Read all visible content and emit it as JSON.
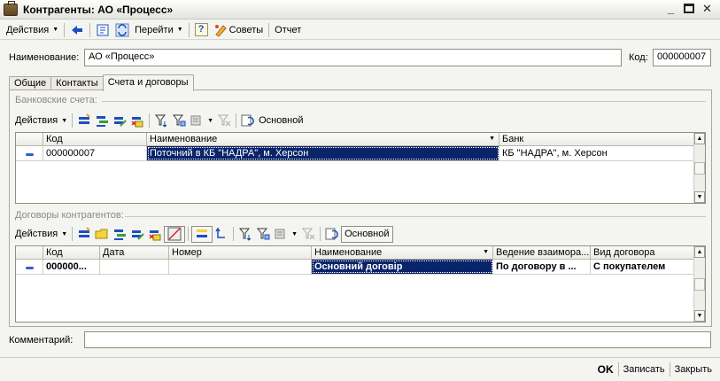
{
  "window": {
    "title": "Контрагенты: АО «Процесс»"
  },
  "toolbar": {
    "actions_label": "Действия",
    "goto_label": "Перейти",
    "help_label": "?",
    "tips_label": "Советы",
    "report_label": "Отчет"
  },
  "header": {
    "name_label": "Наименование:",
    "name_value": "АО «Процесс»",
    "code_label": "Код:",
    "code_value": "000000007"
  },
  "tabs": [
    {
      "label": "Общие"
    },
    {
      "label": "Контакты"
    },
    {
      "label": "Счета и договоры"
    }
  ],
  "bank": {
    "section_title": "Банковские счета:",
    "actions_label": "Действия",
    "main_label": "Основной",
    "columns": [
      "Код",
      "Наименование",
      "Банк"
    ],
    "rows": [
      {
        "code": "000000007",
        "name": "Поточний в КБ \"НАДРА\", м. Херсон",
        "bank": "КБ \"НАДРА\", м. Херсон"
      }
    ]
  },
  "contracts": {
    "section_title": "Договоры контрагентов:",
    "actions_label": "Действия",
    "main_label": "Основной",
    "columns": [
      "Код",
      "Дата",
      "Номер",
      "Наименование",
      "Ведение взаимора...",
      "Вид договора"
    ],
    "rows": [
      {
        "code": "000000...",
        "date": "",
        "number": "",
        "name": "Основний договір",
        "mode": "По договору в ...",
        "type": "С покупателем"
      }
    ]
  },
  "comment": {
    "label": "Комментарий:",
    "value": ""
  },
  "footer": {
    "ok_label": "OK",
    "save_label": "Записать",
    "close_label": "Закрыть"
  }
}
